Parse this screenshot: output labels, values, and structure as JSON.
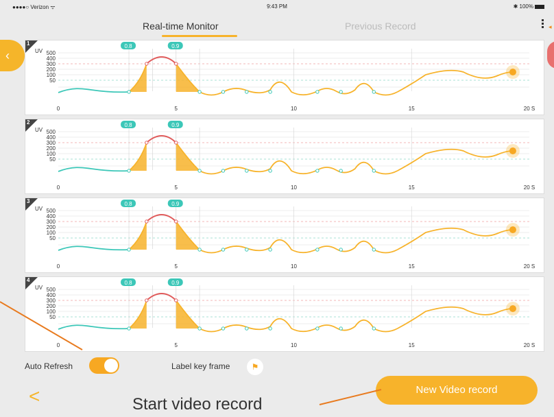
{
  "status_bar": {
    "carrier": "●●●●○ Verizon ᯤ",
    "time": "9:43 PM",
    "battery": "✱ 100%"
  },
  "tabs": [
    {
      "label": "Real-time Monitor",
      "active": true
    },
    {
      "label": "Previous Record",
      "active": false
    }
  ],
  "icons": {
    "back": "chevron-left-icon",
    "menu": "more-vertical-icon",
    "flag": "flag-icon"
  },
  "colors": {
    "accent": "#f7b32b",
    "teal": "#3cc7b8",
    "red": "#e05a5a",
    "panel": "#ffffff"
  },
  "chart_data": [
    {
      "type": "line",
      "panel_number": "1",
      "ylabel": "UV",
      "yticks": [
        50,
        100,
        200,
        300,
        400,
        500
      ],
      "xticks": [
        0,
        5,
        10,
        15,
        20
      ],
      "xunit": "S",
      "xlim": [
        0,
        20
      ],
      "keyframe_labels": [
        "0.8",
        "0.9"
      ]
    },
    {
      "type": "line",
      "panel_number": "2",
      "ylabel": "UV",
      "yticks": [
        50,
        100,
        200,
        300,
        400,
        500
      ],
      "xticks": [
        0,
        5,
        10,
        15,
        20
      ],
      "xunit": "S",
      "xlim": [
        0,
        20
      ],
      "keyframe_labels": [
        "0.8",
        "0.9"
      ]
    },
    {
      "type": "line",
      "panel_number": "3",
      "ylabel": "UV",
      "yticks": [
        50,
        100,
        200,
        300,
        400,
        500
      ],
      "xticks": [
        0,
        5,
        10,
        15,
        20
      ],
      "xunit": "S",
      "xlim": [
        0,
        20
      ],
      "keyframe_labels": [
        "0.8",
        "0.9"
      ]
    },
    {
      "type": "line",
      "panel_number": "4",
      "ylabel": "UV",
      "yticks": [
        50,
        100,
        200,
        300,
        400,
        500
      ],
      "xticks": [
        0,
        5,
        10,
        15,
        20
      ],
      "xunit": "S",
      "xlim": [
        0,
        20
      ],
      "keyframe_labels": [
        "0.8",
        "0.9"
      ]
    }
  ],
  "controls": {
    "auto_refresh_label": "Auto Refresh",
    "auto_refresh_on": true,
    "label_key_frame": "Label key frame"
  },
  "bottom": {
    "back_glyph": "<",
    "new_video_button": "New Video record",
    "annotation": "Start video record"
  }
}
